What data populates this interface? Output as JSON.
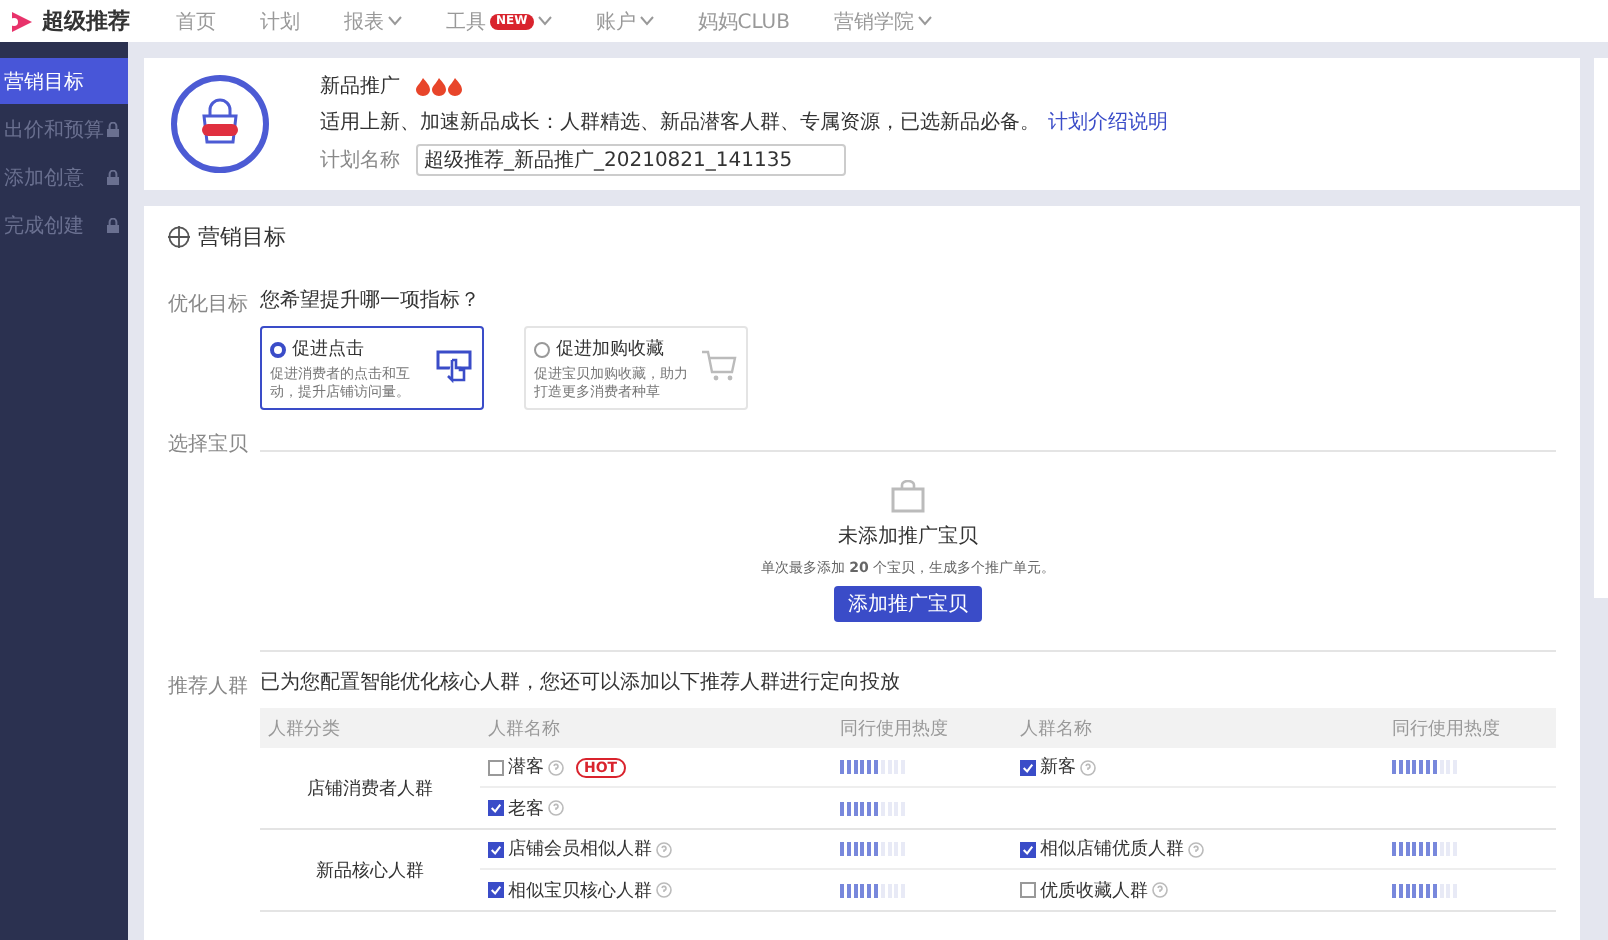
{
  "brand": {
    "name": "超级推荐"
  },
  "nav": [
    {
      "label": "首页",
      "dropdown": false
    },
    {
      "label": "计划",
      "dropdown": false
    },
    {
      "label": "报表",
      "dropdown": true
    },
    {
      "label": "工具",
      "dropdown": true,
      "badge": "NEW"
    },
    {
      "label": "账户",
      "dropdown": true
    },
    {
      "label": "妈妈CLUB",
      "dropdown": false
    },
    {
      "label": "营销学院",
      "dropdown": true
    }
  ],
  "sidebar": {
    "items": [
      {
        "label": "营销目标",
        "selected": true,
        "locked": false
      },
      {
        "label": "出价和预算",
        "selected": false,
        "locked": true
      },
      {
        "label": "添加创意",
        "selected": false,
        "locked": true
      },
      {
        "label": "完成创建",
        "selected": false,
        "locked": true
      }
    ]
  },
  "plan": {
    "title": "新品推广",
    "description": "适用上新、加速新品成长：人群精选、新品潜客人群、专属资源，已选新品必备。",
    "link": "计划介绍说明",
    "name_label": "计划名称",
    "name_value": "超级推荐_新品推广_20210821_141135"
  },
  "section": {
    "title": "营销目标",
    "goal": {
      "label": "优化目标",
      "question": "您希望提升哪一项指标？",
      "options": [
        {
          "title": "促进点击",
          "description": "促进消费者的点击和互动，提升店铺访问量。",
          "selected": true,
          "kind": "click"
        },
        {
          "title": "促进加购收藏",
          "description": "促进宝贝加购收藏，助力打造更多消费者种草",
          "selected": false,
          "kind": "cart"
        }
      ]
    },
    "items": {
      "label": "选择宝贝",
      "empty_title": "未添加推广宝贝",
      "empty_hint": "单次最多添加 **20** 个宝贝，生成多个推广单元。",
      "button": "添加推广宝贝"
    },
    "audience": {
      "label": "推荐人群",
      "hint": "已为您配置智能优化核心人群，您还可以添加以下推荐人群进行定向投放",
      "columns": [
        "人群分类",
        "人群名称",
        "同行使用热度",
        "人群名称",
        "同行使用热度"
      ],
      "groups": [
        {
          "name": "店铺消费者人群",
          "rows": [
            [
              {
                "name": "潜客",
                "checked": false,
                "badge": "HOT",
                "level": 0.6
              },
              {
                "name": "新客",
                "checked": true,
                "level": 0.7
              }
            ],
            [
              {
                "name": "老客",
                "checked": true,
                "level": 0.6
              },
              null
            ]
          ]
        },
        {
          "name": "新品核心人群",
          "rows": [
            [
              {
                "name": "店铺会员相似人群",
                "checked": true,
                "level": 0.6
              },
              {
                "name": "相似店铺优质人群",
                "checked": true,
                "level": 0.7
              }
            ],
            [
              {
                "name": "相似宝贝核心人群",
                "checked": true,
                "level": 0.6
              },
              {
                "name": "优质收藏人群",
                "checked": false,
                "level": 0.7
              }
            ]
          ]
        }
      ]
    }
  }
}
